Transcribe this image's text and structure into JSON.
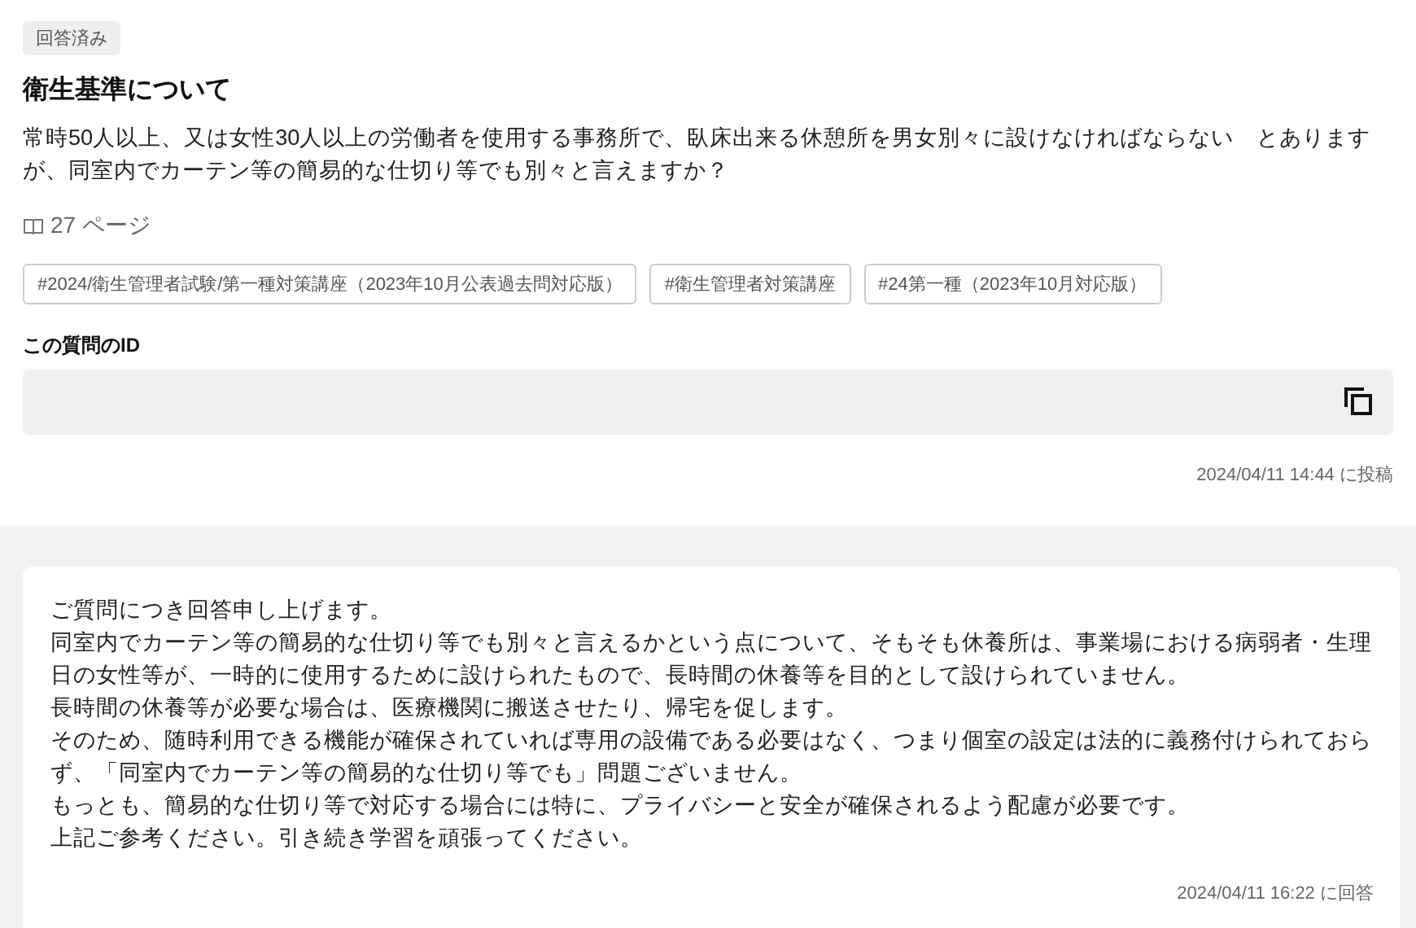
{
  "question": {
    "status": "回答済み",
    "title": "衛生基準について",
    "body": "常時50人以上、又は女性30人以上の労働者を使用する事務所で、臥床出来る休憩所を男女別々に設けなければならない　とありますが、同室内でカーテン等の簡易的な仕切り等でも別々と言えますか？",
    "page": "27 ページ",
    "tags": [
      "#2024/衛生管理者試験/第一種対策講座（2023年10月公表過去問対応版）",
      "#衛生管理者対策講座",
      "#24第一種（2023年10月対応版）"
    ],
    "id_label": "この質問のID",
    "posted": "2024/04/11 14:44 に投稿"
  },
  "answer": {
    "paragraphs": [
      "ご質問につき回答申し上げます。",
      "同室内でカーテン等の簡易的な仕切り等でも別々と言えるかという点について、そもそも休養所は、事業場における病弱者・生理日の女性等が、一時的に使用するために設けられたもので、長時間の休養等を目的として設けられていません。",
      "長時間の休養等が必要な場合は、医療機関に搬送させたり、帰宅を促します。",
      "そのため、随時利用できる機能が確保されていれば専用の設備である必要はなく、つまり個室の設定は法的に義務付けられておらず、「同室内でカーテン等の簡易的な仕切り等でも」問題ございません。",
      "もっとも、簡易的な仕切り等で対応する場合には特に、プライバシーと安全が確保されるよう配慮が必要です。",
      "上記ご参考ください。引き続き学習を頑張ってください。"
    ],
    "answered": "2024/04/11 16:22 に回答"
  }
}
